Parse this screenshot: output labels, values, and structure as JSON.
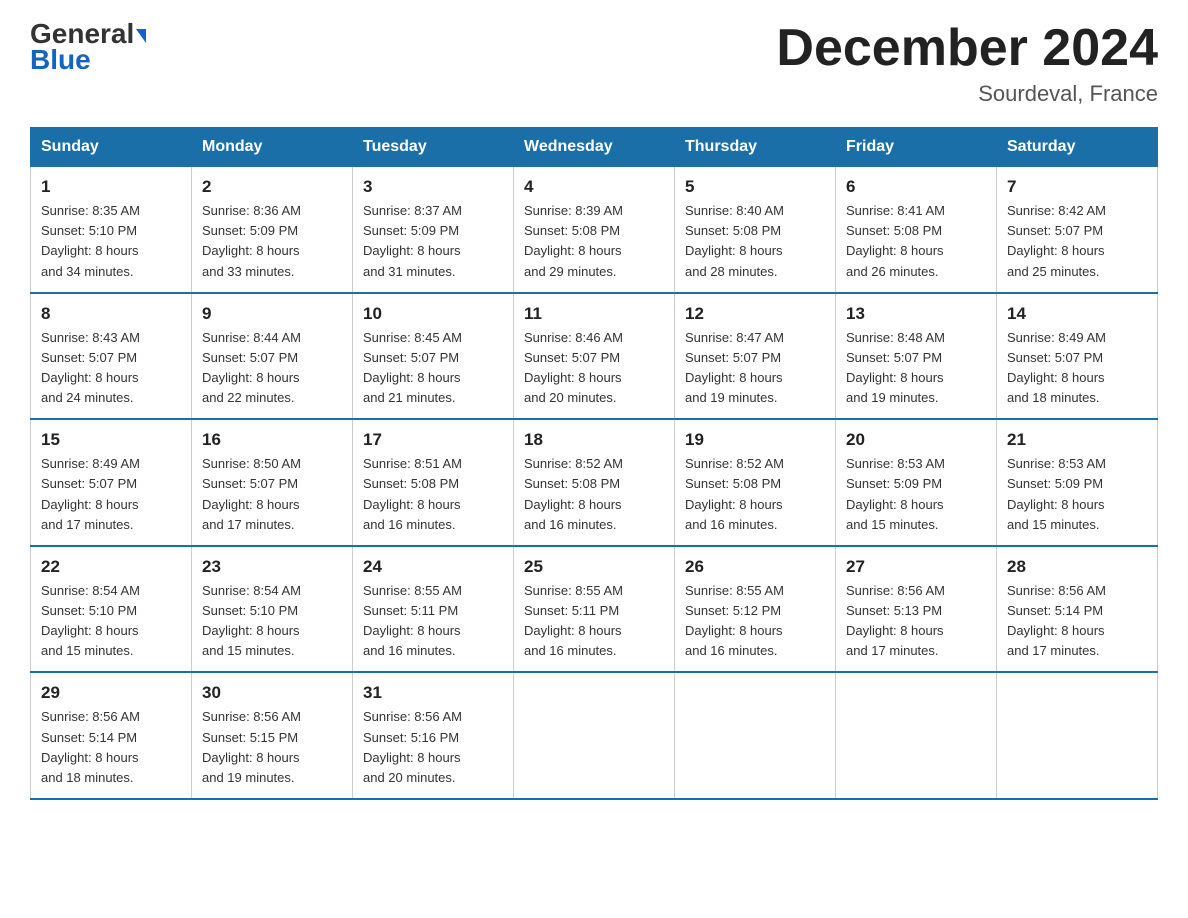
{
  "header": {
    "logo_line1": "General",
    "logo_line2": "Blue",
    "title": "December 2024",
    "location": "Sourdeval, France"
  },
  "days_of_week": [
    "Sunday",
    "Monday",
    "Tuesday",
    "Wednesday",
    "Thursday",
    "Friday",
    "Saturday"
  ],
  "weeks": [
    [
      {
        "day": "1",
        "sunrise": "8:35 AM",
        "sunset": "5:10 PM",
        "daylight": "8 hours and 34 minutes."
      },
      {
        "day": "2",
        "sunrise": "8:36 AM",
        "sunset": "5:09 PM",
        "daylight": "8 hours and 33 minutes."
      },
      {
        "day": "3",
        "sunrise": "8:37 AM",
        "sunset": "5:09 PM",
        "daylight": "8 hours and 31 minutes."
      },
      {
        "day": "4",
        "sunrise": "8:39 AM",
        "sunset": "5:08 PM",
        "daylight": "8 hours and 29 minutes."
      },
      {
        "day": "5",
        "sunrise": "8:40 AM",
        "sunset": "5:08 PM",
        "daylight": "8 hours and 28 minutes."
      },
      {
        "day": "6",
        "sunrise": "8:41 AM",
        "sunset": "5:08 PM",
        "daylight": "8 hours and 26 minutes."
      },
      {
        "day": "7",
        "sunrise": "8:42 AM",
        "sunset": "5:07 PM",
        "daylight": "8 hours and 25 minutes."
      }
    ],
    [
      {
        "day": "8",
        "sunrise": "8:43 AM",
        "sunset": "5:07 PM",
        "daylight": "8 hours and 24 minutes."
      },
      {
        "day": "9",
        "sunrise": "8:44 AM",
        "sunset": "5:07 PM",
        "daylight": "8 hours and 22 minutes."
      },
      {
        "day": "10",
        "sunrise": "8:45 AM",
        "sunset": "5:07 PM",
        "daylight": "8 hours and 21 minutes."
      },
      {
        "day": "11",
        "sunrise": "8:46 AM",
        "sunset": "5:07 PM",
        "daylight": "8 hours and 20 minutes."
      },
      {
        "day": "12",
        "sunrise": "8:47 AM",
        "sunset": "5:07 PM",
        "daylight": "8 hours and 19 minutes."
      },
      {
        "day": "13",
        "sunrise": "8:48 AM",
        "sunset": "5:07 PM",
        "daylight": "8 hours and 19 minutes."
      },
      {
        "day": "14",
        "sunrise": "8:49 AM",
        "sunset": "5:07 PM",
        "daylight": "8 hours and 18 minutes."
      }
    ],
    [
      {
        "day": "15",
        "sunrise": "8:49 AM",
        "sunset": "5:07 PM",
        "daylight": "8 hours and 17 minutes."
      },
      {
        "day": "16",
        "sunrise": "8:50 AM",
        "sunset": "5:07 PM",
        "daylight": "8 hours and 17 minutes."
      },
      {
        "day": "17",
        "sunrise": "8:51 AM",
        "sunset": "5:08 PM",
        "daylight": "8 hours and 16 minutes."
      },
      {
        "day": "18",
        "sunrise": "8:52 AM",
        "sunset": "5:08 PM",
        "daylight": "8 hours and 16 minutes."
      },
      {
        "day": "19",
        "sunrise": "8:52 AM",
        "sunset": "5:08 PM",
        "daylight": "8 hours and 16 minutes."
      },
      {
        "day": "20",
        "sunrise": "8:53 AM",
        "sunset": "5:09 PM",
        "daylight": "8 hours and 15 minutes."
      },
      {
        "day": "21",
        "sunrise": "8:53 AM",
        "sunset": "5:09 PM",
        "daylight": "8 hours and 15 minutes."
      }
    ],
    [
      {
        "day": "22",
        "sunrise": "8:54 AM",
        "sunset": "5:10 PM",
        "daylight": "8 hours and 15 minutes."
      },
      {
        "day": "23",
        "sunrise": "8:54 AM",
        "sunset": "5:10 PM",
        "daylight": "8 hours and 15 minutes."
      },
      {
        "day": "24",
        "sunrise": "8:55 AM",
        "sunset": "5:11 PM",
        "daylight": "8 hours and 16 minutes."
      },
      {
        "day": "25",
        "sunrise": "8:55 AM",
        "sunset": "5:11 PM",
        "daylight": "8 hours and 16 minutes."
      },
      {
        "day": "26",
        "sunrise": "8:55 AM",
        "sunset": "5:12 PM",
        "daylight": "8 hours and 16 minutes."
      },
      {
        "day": "27",
        "sunrise": "8:56 AM",
        "sunset": "5:13 PM",
        "daylight": "8 hours and 17 minutes."
      },
      {
        "day": "28",
        "sunrise": "8:56 AM",
        "sunset": "5:14 PM",
        "daylight": "8 hours and 17 minutes."
      }
    ],
    [
      {
        "day": "29",
        "sunrise": "8:56 AM",
        "sunset": "5:14 PM",
        "daylight": "8 hours and 18 minutes."
      },
      {
        "day": "30",
        "sunrise": "8:56 AM",
        "sunset": "5:15 PM",
        "daylight": "8 hours and 19 minutes."
      },
      {
        "day": "31",
        "sunrise": "8:56 AM",
        "sunset": "5:16 PM",
        "daylight": "8 hours and 20 minutes."
      },
      {
        "day": "",
        "sunrise": "",
        "sunset": "",
        "daylight": ""
      },
      {
        "day": "",
        "sunrise": "",
        "sunset": "",
        "daylight": ""
      },
      {
        "day": "",
        "sunrise": "",
        "sunset": "",
        "daylight": ""
      },
      {
        "day": "",
        "sunrise": "",
        "sunset": "",
        "daylight": ""
      }
    ]
  ],
  "labels": {
    "sunrise": "Sunrise:",
    "sunset": "Sunset:",
    "daylight": "Daylight:"
  }
}
